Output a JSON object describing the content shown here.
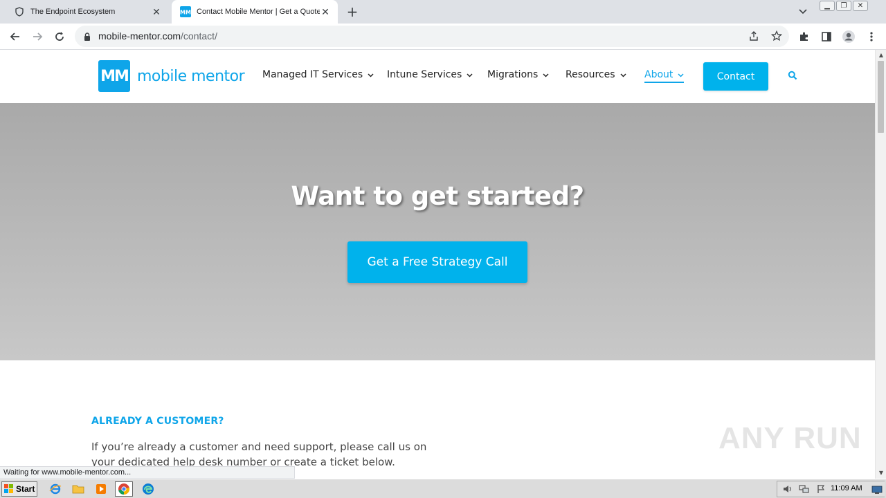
{
  "browser": {
    "tabs": [
      {
        "title": "The Endpoint Ecosystem",
        "active": false
      },
      {
        "title": "Contact Mobile Mentor | Get a Quote",
        "active": true
      }
    ],
    "url_host": "mobile-mentor.com",
    "url_path": "/contact/",
    "status_text": "Waiting for www.mobile-mentor.com..."
  },
  "site": {
    "logo_mark": "MM",
    "logo_text": "mobile mentor",
    "nav": [
      {
        "label": "Managed IT Services"
      },
      {
        "label": "Intune Services"
      },
      {
        "label": "Migrations"
      },
      {
        "label": "Resources"
      },
      {
        "label": "About"
      }
    ],
    "contact_label": "Contact",
    "accent_color": "#00b2ec"
  },
  "hero": {
    "title": "Want to get started?",
    "cta_label": "Get a Free Strategy Call"
  },
  "section": {
    "eyebrow": "ALREADY A CUSTOMER?",
    "body": "If you’re already a customer and need support, please call us on your dedicated help desk number or create a ticket below."
  },
  "watermark": "ANY RUN",
  "taskbar": {
    "start_label": "Start",
    "clock": "11:09 AM"
  }
}
